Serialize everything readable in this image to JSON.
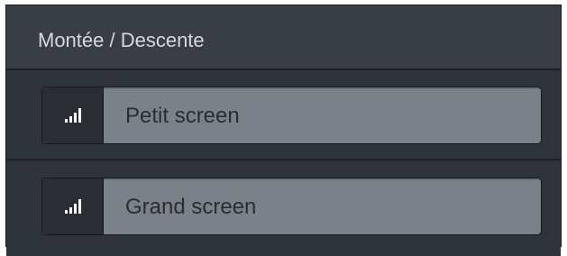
{
  "panel": {
    "title": "Montée / Descente"
  },
  "inputs": [
    {
      "placeholder": "Petit screen",
      "icon": "signal-bars-icon"
    },
    {
      "placeholder": "Grand screen",
      "icon": "signal-bars-icon"
    }
  ],
  "colors": {
    "panel_bg": "#2c3036",
    "header_bg": "#393d44",
    "field_bg": "#7b8188",
    "addon_bg": "#2a2e34",
    "title_text": "#d6d9dc",
    "field_text": "#2a2d31"
  }
}
